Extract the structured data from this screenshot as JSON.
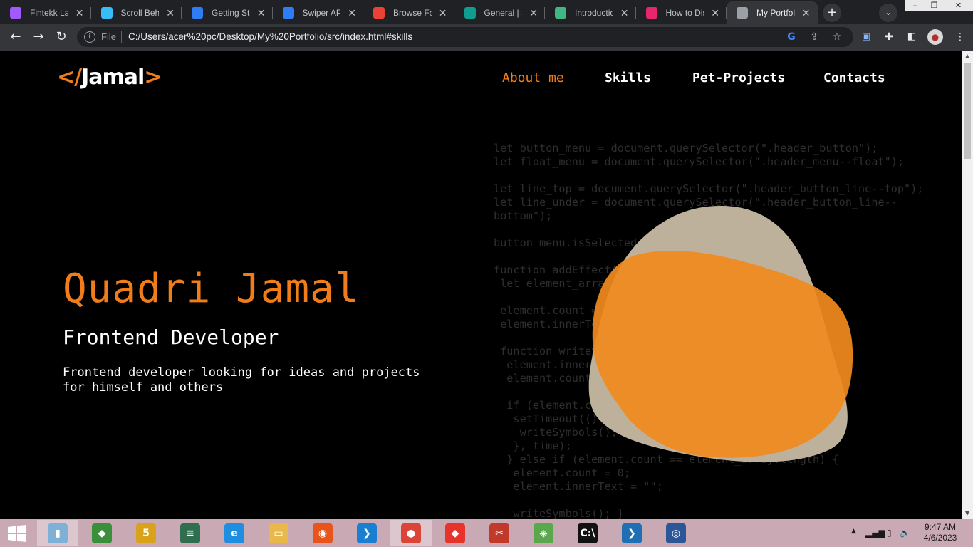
{
  "browser": {
    "tabs": [
      {
        "title": "Fintekk Landing",
        "color": "#a259ff",
        "active": false
      },
      {
        "title": "Scroll Behavior",
        "color": "#38bdf8",
        "active": false
      },
      {
        "title": "Getting Started",
        "color": "#2e7cf6",
        "active": false
      },
      {
        "title": "Swiper API",
        "color": "#2e7cf6",
        "active": false
      },
      {
        "title": "Browse Fonts",
        "color": "#ea4335",
        "active": false
      },
      {
        "title": "General | Slack",
        "color": "#0f9d8f",
        "active": false
      },
      {
        "title": "Introduction",
        "color": "#41b883",
        "active": false
      },
      {
        "title": "How to Disable",
        "color": "#e8266d",
        "active": false
      },
      {
        "title": "My Portfolio",
        "color": "#9aa0a6",
        "active": true
      }
    ],
    "new_tab_glyph": "+",
    "tab_search_glyph": "⌄",
    "address": {
      "scheme_label": "File",
      "url": "C:/Users/acer%20pc/Desktop/My%20Portfolio/src/index.html#skills"
    },
    "window_controls": [
      "–",
      "❐",
      "✕"
    ]
  },
  "page": {
    "logo": {
      "open": "</",
      "name": "Jamal",
      "close": ">"
    },
    "nav": [
      {
        "label": "About me",
        "current": true
      },
      {
        "label": "Skills",
        "current": false
      },
      {
        "label": "Pet-Projects",
        "current": false
      },
      {
        "label": "Contacts",
        "current": false
      }
    ],
    "hero": {
      "name": "Quadri Jamal",
      "role": "Frontend Developer",
      "description": "Frontend developer looking for ideas and projects for himself and others"
    },
    "code_background": [
      "let button_menu = document.querySelector(\".header_button\");",
      "let float_menu = document.querySelector(\".header_menu--float\");",
      "",
      "let line_top = document.querySelector(\".header_button_line--top\");",
      "let line_under = document.querySelector(\".header_button_line--",
      "bottom\");",
      "",
      "button_menu.isSelected = false;",
      "",
      "function addEffect(element, time) {",
      " let element_array = element.innerText;",
      "",
      " element.count = 0;",
      " element.innerText = \"\";",
      "",
      " function writeSymbols() {",
      "  element.innerText += element_array[element.count];",
      "  element.count++;",
      "",
      "  if (element.count < element_array.length) {",
      "   setTimeout(() => {",
      "    writeSymbols();",
      "   }, time);",
      "  } else if (element.count == element_array.length) {",
      "   element.count = 0;",
      "   element.innerText = \"\";",
      "",
      "   writeSymbols(); }"
    ],
    "colors": {
      "accent": "#f07d1a",
      "blob_back": "#beb19c",
      "blob_front": "#f08a1e"
    }
  },
  "taskbar": {
    "apps": [
      {
        "icon": "file-explorer-alt-icon",
        "glyph": "▮",
        "color": "#7fb0d6",
        "active": true
      },
      {
        "icon": "metatrader-icon",
        "glyph": "◆",
        "color": "#3a8f3a",
        "active": false
      },
      {
        "icon": "sublime-icon",
        "glyph": "5",
        "color": "#d9a21a",
        "active": false
      },
      {
        "icon": "notepad-icon",
        "glyph": "≡",
        "color": "#2f6f4f",
        "active": false
      },
      {
        "icon": "internet-explorer-icon",
        "glyph": "e",
        "color": "#1e8fe0",
        "active": false
      },
      {
        "icon": "file-explorer-icon",
        "glyph": "▭",
        "color": "#e8b84a",
        "active": false
      },
      {
        "icon": "firefox-icon",
        "glyph": "◉",
        "color": "#e8541a",
        "active": false
      },
      {
        "icon": "vscode-icon",
        "glyph": "❯",
        "color": "#1b7fd1",
        "active": false
      },
      {
        "icon": "chrome-icon",
        "glyph": "●",
        "color": "#db4437",
        "active": true
      },
      {
        "icon": "anydesk-icon",
        "glyph": "◆",
        "color": "#e8332a",
        "active": false
      },
      {
        "icon": "snipping-tool-icon",
        "glyph": "✂",
        "color": "#c0392b",
        "active": false
      },
      {
        "icon": "git-icon",
        "glyph": "◈",
        "color": "#5aa84c",
        "active": false
      },
      {
        "icon": "cmd-icon",
        "glyph": "C:\\",
        "color": "#111111",
        "active": false
      },
      {
        "icon": "powershell-icon",
        "glyph": "❯",
        "color": "#1f6fb5",
        "active": false
      },
      {
        "icon": "screen-recorder-icon",
        "glyph": "◎",
        "color": "#2b5797",
        "active": false
      }
    ],
    "clock": {
      "time": "9:47 AM",
      "date": "4/6/2023"
    }
  }
}
